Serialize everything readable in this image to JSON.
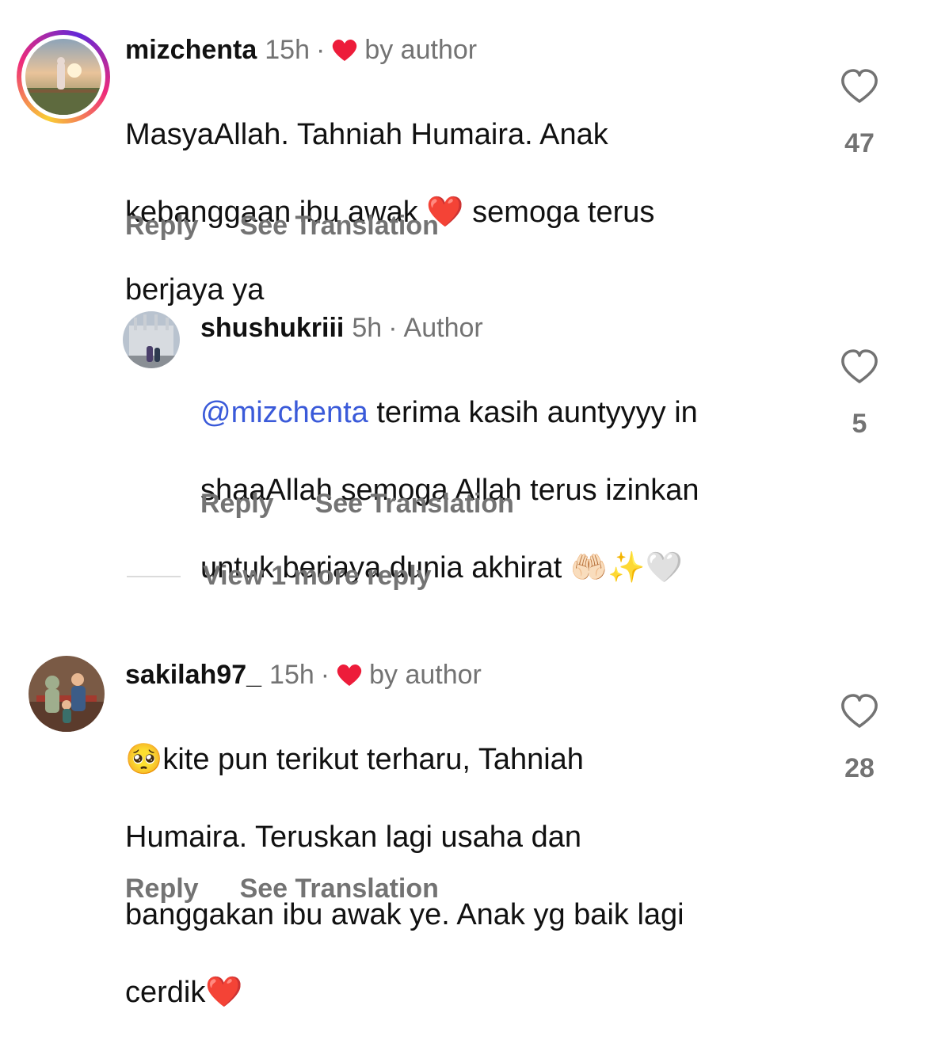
{
  "comments": [
    {
      "username": "mizchenta",
      "time": "15h",
      "separator": "·",
      "author_tag": "by author",
      "body_line1": "MasyaAllah. Tahniah Humaira. Anak",
      "body_line2": "kebanggaan ibu awak ❤️ semoga terus",
      "body_line3": "berjaya ya",
      "reply_label": "Reply",
      "translate_label": "See Translation",
      "likes": "47"
    },
    {
      "username": "shushukriii",
      "time": "5h",
      "separator": "·",
      "author_tag": "Author",
      "mention": "@mizchenta",
      "body_line1_rest": " terima kasih auntyyyy in",
      "body_line2": "shaaAllah semoga Allah terus izinkan",
      "body_line3": "untuk berjaya dunia akhirat 🤲🏻✨🤍",
      "reply_label": "Reply",
      "translate_label": "See Translation",
      "likes": "5"
    },
    {
      "username": "sakilah97_",
      "time": "15h",
      "separator": "·",
      "author_tag": "by author",
      "body_line1": "🥺kite pun terikut terharu, Tahniah",
      "body_line2": "Humaira. Teruskan lagi usaha dan",
      "body_line3": "banggakan ibu awak ye. Anak yg baik lagi",
      "body_line4": "cerdik❤️",
      "reply_label": "Reply",
      "translate_label": "See Translation",
      "likes": "28"
    }
  ],
  "view_more_label": "View 1 more reply",
  "colors": {
    "text": "#111111",
    "muted": "#737373",
    "mention": "#3a5ad9",
    "heart": "#ed1c3a"
  },
  "icons": {
    "like": "heart-outline-icon",
    "author_like": "heart-filled-icon"
  }
}
